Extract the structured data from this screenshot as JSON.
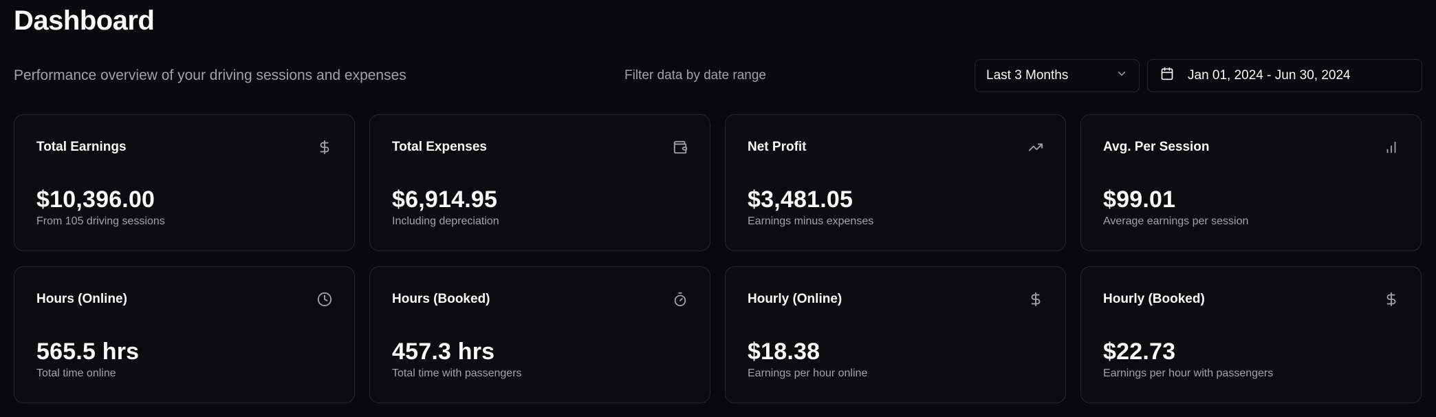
{
  "header": {
    "title": "Dashboard",
    "subtitle": "Performance overview of your driving sessions and expenses"
  },
  "filter": {
    "label": "Filter data by date range",
    "range_select": "Last 3 Months",
    "date_range": "Jan 01, 2024 - Jun 30, 2024"
  },
  "cards": [
    {
      "title": "Total Earnings",
      "value": "$10,396.00",
      "desc": "From 105 driving sessions",
      "icon": "dollar-icon"
    },
    {
      "title": "Total Expenses",
      "value": "$6,914.95",
      "desc": "Including depreciation",
      "icon": "wallet-icon"
    },
    {
      "title": "Net Profit",
      "value": "$3,481.05",
      "desc": "Earnings minus expenses",
      "icon": "trending-up-icon"
    },
    {
      "title": "Avg. Per Session",
      "value": "$99.01",
      "desc": "Average earnings per session",
      "icon": "bar-chart-icon"
    },
    {
      "title": "Hours (Online)",
      "value": "565.5 hrs",
      "desc": "Total time online",
      "icon": "clock-icon"
    },
    {
      "title": "Hours (Booked)",
      "value": "457.3 hrs",
      "desc": "Total time with passengers",
      "icon": "timer-icon"
    },
    {
      "title": "Hourly (Online)",
      "value": "$18.38",
      "desc": "Earnings per hour online",
      "icon": "dollar-icon"
    },
    {
      "title": "Hourly (Booked)",
      "value": "$22.73",
      "desc": "Earnings per hour with passengers",
      "icon": "dollar-icon"
    }
  ],
  "colors": {
    "background": "#09090b",
    "border": "#27272a",
    "text": "#fafafa",
    "muted": "#a1a1aa"
  }
}
